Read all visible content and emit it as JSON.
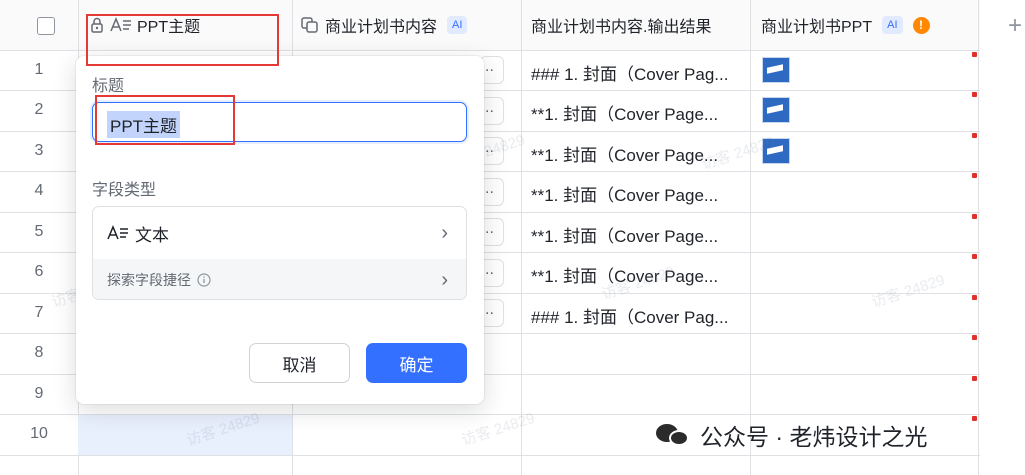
{
  "header": {
    "col1": "PPT主题",
    "col2": "商业计划书内容",
    "col2_tag": "AI",
    "col3": "商业计划书内容.输出结果",
    "col4": "商业计划书PPT",
    "col4_tag": "AI",
    "col4_warn": "!",
    "add_column": "+"
  },
  "rows": [
    {
      "num": "1",
      "text": "### 1. 封面（Cover Pag...",
      "has_ppt": true
    },
    {
      "num": "2",
      "text": "**1. 封面（Cover Page...",
      "has_ppt": true
    },
    {
      "num": "3",
      "text": "**1. 封面（Cover Page...",
      "has_ppt": true
    },
    {
      "num": "4",
      "text": "**1. 封面（Cover Page...",
      "has_ppt": false
    },
    {
      "num": "5",
      "text": "**1. 封面（Cover Page...",
      "has_ppt": false
    },
    {
      "num": "6",
      "text": "**1. 封面（Cover Page...",
      "has_ppt": false
    },
    {
      "num": "7",
      "text": "### 1. 封面（Cover Pag...",
      "has_ppt": false
    },
    {
      "num": "8",
      "text": "",
      "has_ppt": false
    },
    {
      "num": "9",
      "text": "",
      "has_ppt": false
    },
    {
      "num": "10",
      "text": "",
      "has_ppt": false
    }
  ],
  "popup": {
    "title_label": "标题",
    "title_value": "PPT主题",
    "type_label": "字段类型",
    "type_value": "文本",
    "explore_label": "探索字段捷径",
    "cancel": "取消",
    "confirm": "确定"
  },
  "watermark": "访客 24829",
  "brand": "公众号 · 老炜设计之光",
  "colors": {
    "accent": "#3370ff",
    "highlight_box": "#e53935",
    "warning": "#ff8800"
  }
}
